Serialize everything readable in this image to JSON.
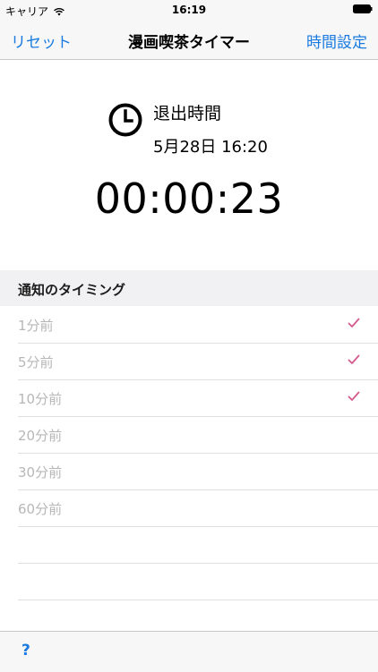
{
  "status_bar": {
    "carrier": "キャリア",
    "time": "16:19",
    "icons": [
      "wifi-icon",
      "battery-icon"
    ]
  },
  "nav": {
    "left_label": "リセット",
    "title": "漫画喫茶タイマー",
    "right_label": "時間設定"
  },
  "exit": {
    "label": "退出時間",
    "time": "5月28日 16:20",
    "icon": "clock-icon"
  },
  "countdown": "00:00:23",
  "notifications": {
    "header": "通知のタイミング",
    "items": [
      {
        "label": "1分前",
        "checked": true
      },
      {
        "label": "5分前",
        "checked": true
      },
      {
        "label": "10分前",
        "checked": true
      },
      {
        "label": "20分前",
        "checked": false
      },
      {
        "label": "30分前",
        "checked": false
      },
      {
        "label": "60分前",
        "checked": false
      }
    ]
  },
  "toolbar": {
    "help_label": "?"
  },
  "colors": {
    "accent": "#1a7ae0",
    "check": "#d45a8c",
    "disabled_text": "#b7b7b7"
  }
}
